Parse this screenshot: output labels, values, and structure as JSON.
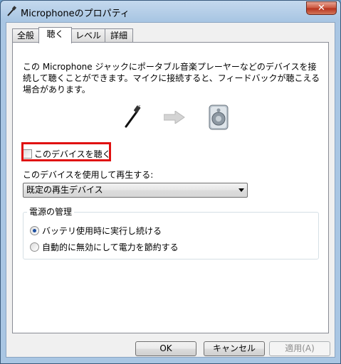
{
  "window": {
    "title": "Microphoneのプロパティ",
    "close_label": "✕"
  },
  "tabs": [
    {
      "label": "全般",
      "active": false
    },
    {
      "label": "聴く",
      "active": true
    },
    {
      "label": "レベル",
      "active": false
    },
    {
      "label": "詳細",
      "active": false
    }
  ],
  "listen": {
    "description": "この Microphone ジャックにポータブル音楽プレーヤーなどのデバイスを接続して聴くことができます。マイクに接続すると、フィードバックが聴こえる場合があります。",
    "checkbox_label": "このデバイスを聴く",
    "checkbox_checked": false,
    "playback_label": "このデバイスを使用して再生する:",
    "playback_selected": "既定の再生デバイス"
  },
  "power": {
    "group_title": "電源の管理",
    "options": [
      {
        "label": "バッテリ使用時に実行し続ける",
        "checked": true
      },
      {
        "label": "自動的に無効にして電力を節約する",
        "checked": false
      }
    ]
  },
  "buttons": {
    "ok": "OK",
    "cancel": "キャンセル",
    "apply": "適用(A)"
  },
  "colors": {
    "highlight": "#e01010",
    "selected_radio": "#1d4fa0"
  }
}
